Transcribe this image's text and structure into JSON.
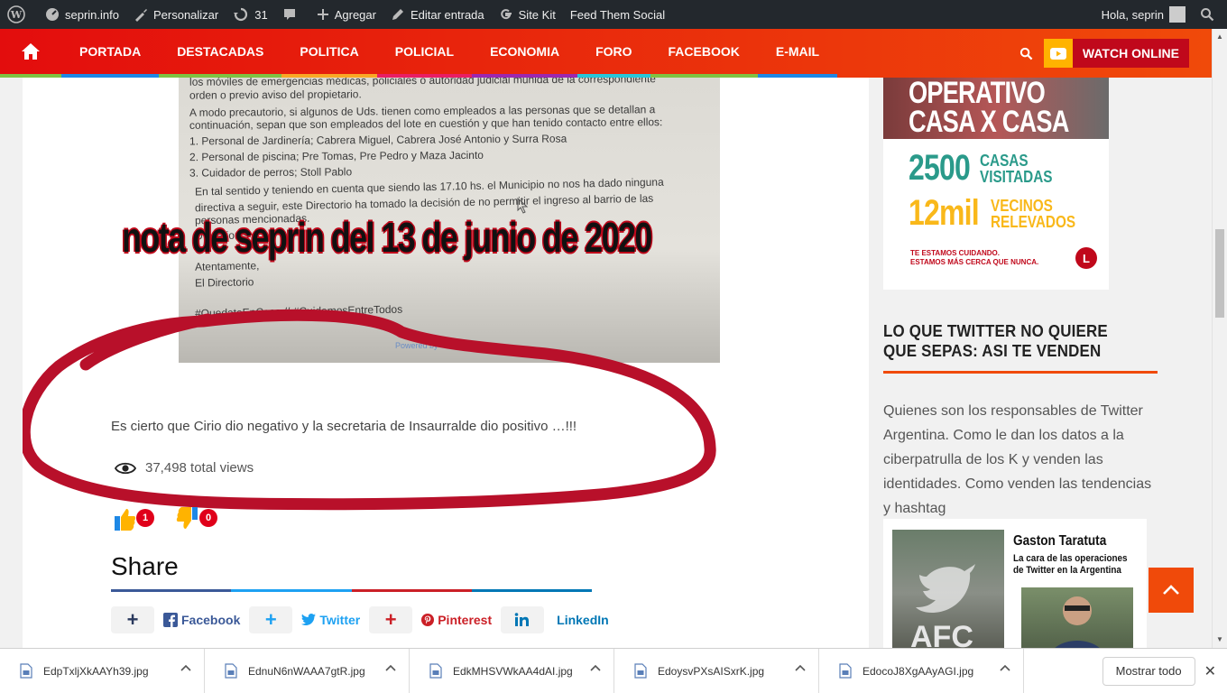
{
  "adminbar": {
    "site": "seprin.info",
    "customize": "Personalizar",
    "updates": "31",
    "add": "Agregar",
    "edit": "Editar entrada",
    "sitekit": "Site Kit",
    "feed": "Feed Them Social",
    "greeting": "Hola, seprin"
  },
  "nav": {
    "items": [
      "PORTADA",
      "DESTACADAS",
      "POLITICA",
      "POLICIAL",
      "ECONOMIA",
      "FORO",
      "FACEBOOK",
      "E-MAIL"
    ],
    "underline_colors": [
      "#1e88e5",
      "#7fc242",
      "#f9a825",
      "#e91e63",
      "#9c27b0",
      "#26c6da",
      "#7fc242",
      "#1e88e5"
    ],
    "watch": "WATCH ONLINE"
  },
  "note": {
    "lines": [
      "los móviles de emergencias médicas, policiales o autoridad judicial munida de la correspondiente",
      "orden o previo aviso del propietario.",
      "A modo precautorio, si algunos de Uds. tienen como empleados a las personas que se detallan a",
      "continuación, sepan que son empleados del lote en cuestión y que han tenido contacto entre ellos:",
      "1. Personal de Jardinería; Cabrera Miguel, Cabrera José Antonio y Surra Rosa",
      "2. Personal de piscina; Pre Tomas, Pre Pedro y  Maza Jacinto",
      "3. Cuidador de perros; Stoll Pablo",
      "En tal sentido y teniendo en cuenta que siendo las 17.10 hs. el Municipio no nos ha dado ninguna",
      "directiva a seguir, este Directorio ha tomado la decisión de no permitir el ingreso al barrio de las",
      "personas mencionadas.",
      "D                     u             la               ion                    s",
      "Atentamente,",
      "El Directorio",
      "",
      "#QuedateEnCasa  //  #CuidemosEntreTodos"
    ],
    "overlay": "nota de seprin del 13 de junio de 2020"
  },
  "post": {
    "text": "Es cierto que  Cirio dio negativo y la secretaria de Insaurralde dio positivo …!!!",
    "views": "37,498 total views",
    "likes": "1",
    "dislikes": "0"
  },
  "share": {
    "title": "Share",
    "bar_colors": [
      "#3b5998",
      "#1da1f2",
      "#cb2027",
      "#0077b5"
    ],
    "buttons": [
      {
        "label": "Facebook",
        "color": "#3b5998"
      },
      {
        "label": "Twitter",
        "color": "#1da1f2"
      },
      {
        "label": "Pinterest",
        "color": "#cb2027"
      },
      {
        "label": "LinkedIn",
        "color": "#0077b5"
      }
    ]
  },
  "promo": {
    "line1": "OPERATIVO",
    "line2": "CASA X CASA",
    "stat1_big": "2500",
    "stat1_sm1": "CASAS",
    "stat1_sm2": "VISITADAS",
    "stat2_big": "12mil",
    "stat2_sm1": "VECINOS",
    "stat2_sm2": "RELEVADOS",
    "foot1": "TE ESTAMOS CUIDANDO.",
    "foot2": "ESTAMOS MÁS CERCA QUE NUNCA."
  },
  "widget": {
    "title": "LO QUE TWITTER NO QUIERE QUE SEPAS: ASI TE VENDEN",
    "body": "Quienes son los responsables de Twitter Argentina.  Como le dan los datos a la ciberpatrulla de los K y venden las identidades. Como venden las tendencias y hashtag",
    "img_title": "Gaston Taratuta",
    "img_sub1": "La cara de las operaciones",
    "img_sub2": "de Twitter en la Argentina"
  },
  "downloads": {
    "files": [
      "EdpTxljXkAAYh39.jpg",
      "EdnuN6nWAAA7gtR.jpg",
      "EdkMHSVWkAA4dAI.jpg",
      "EdoysvPXsAISxrK.jpg",
      "EdocoJ8XgAAyAGI.jpg"
    ],
    "show_all": "Mostrar todo"
  }
}
